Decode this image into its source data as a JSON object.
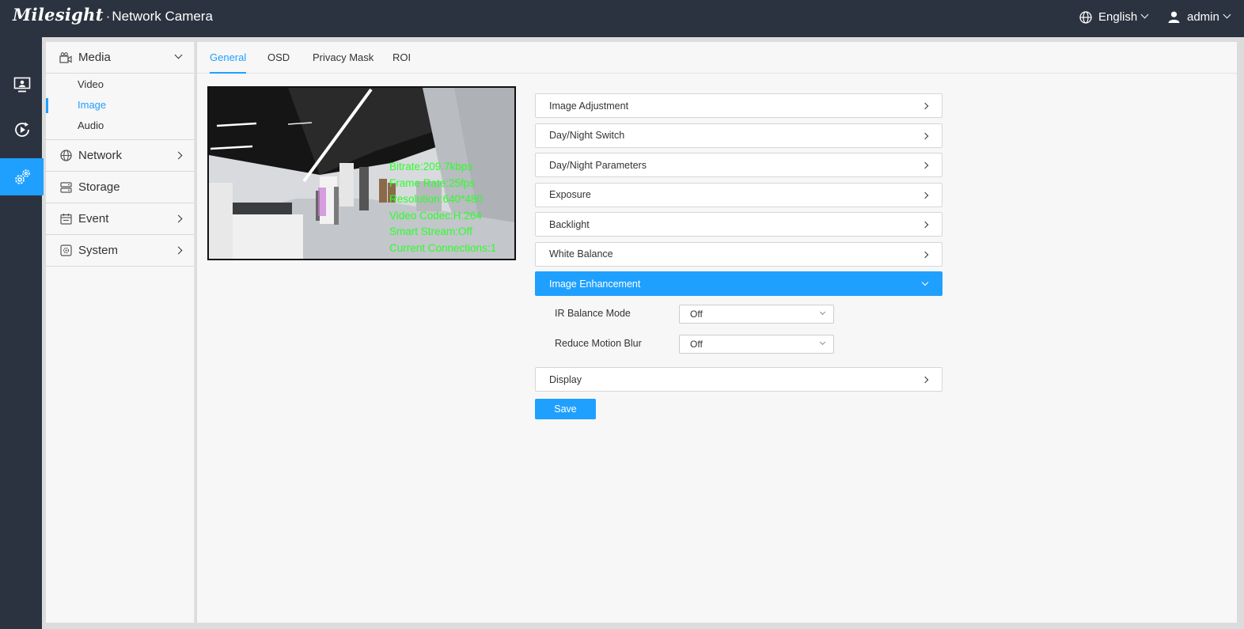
{
  "header": {
    "brand_logo": "Milesight",
    "brand_separator": "·",
    "brand_name": "Network Camera",
    "language": "English",
    "user": "admin"
  },
  "rail": [
    {
      "icon": "live-view-icon"
    },
    {
      "icon": "playback-icon"
    },
    {
      "icon": "settings-icon",
      "active": true
    }
  ],
  "menu": {
    "media": {
      "label": "Media",
      "subitems": [
        "Video",
        "Image",
        "Audio"
      ],
      "active": "Image"
    },
    "network": "Network",
    "storage": "Storage",
    "event": "Event",
    "system": "System"
  },
  "tabs": [
    "General",
    "OSD",
    "Privacy Mask",
    "ROI"
  ],
  "active_tab": "General",
  "preview": {
    "osd_lines": [
      "Bitrate:209.7kbps",
      "Frame Rate:25fps",
      "Resolution:640*480",
      "Video Codec:H.264",
      "Smart Stream:Off",
      "Current Connections:1"
    ]
  },
  "sections": {
    "image_adjustment": "Image Adjustment",
    "day_night_switch": "Day/Night Switch",
    "day_night_parameters": "Day/Night Parameters",
    "exposure": "Exposure",
    "backlight": "Backlight",
    "white_balance": "White Balance",
    "image_enhancement": "Image Enhancement",
    "display": "Display"
  },
  "image_enhancement": {
    "ir_balance_mode": {
      "label": "IR Balance Mode",
      "value": "Off"
    },
    "reduce_motion_blur": {
      "label": "Reduce Motion Blur",
      "value": "Off"
    }
  },
  "save_label": "Save",
  "colors": {
    "accent": "#1fa0ff",
    "header": "#2b3340",
    "osd": "#2bff2b"
  }
}
